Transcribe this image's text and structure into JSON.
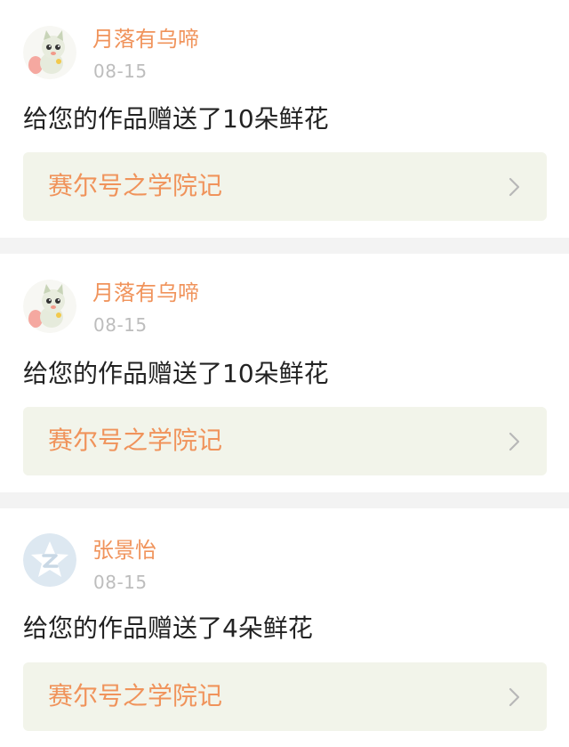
{
  "notifications": [
    {
      "user_name": "月落有乌啼",
      "date": "08-15",
      "message": "给您的作品赠送了10朵鲜花",
      "work_title": "赛尔号之学院记",
      "avatar_icon": "cartoon-cat-avatar-icon"
    },
    {
      "user_name": "月落有乌啼",
      "date": "08-15",
      "message": "给您的作品赠送了10朵鲜花",
      "work_title": "赛尔号之学院记",
      "avatar_icon": "cartoon-cat-avatar-icon"
    },
    {
      "user_name": "张景怡",
      "date": "08-15",
      "message": "给您的作品赠送了4朵鲜花",
      "work_title": "赛尔号之学院记",
      "avatar_icon": "qq-default-avatar-icon"
    }
  ],
  "colors": {
    "accent": "#f0935b",
    "link_background": "#f2f4ea",
    "divider": "#f3f3f3",
    "date_text": "#bdbdbd",
    "message_text": "#222222"
  },
  "icons": {
    "chevron": "chevron-right-icon"
  }
}
